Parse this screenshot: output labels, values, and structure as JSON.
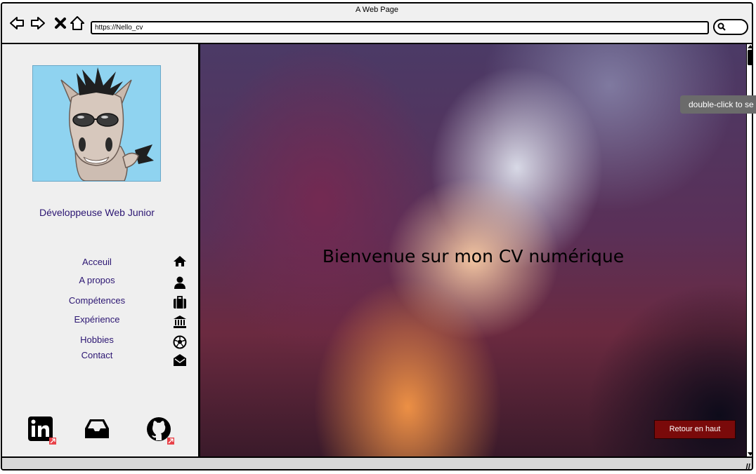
{
  "window": {
    "title": "A Web Page"
  },
  "browser": {
    "url": "https://Nello_cv"
  },
  "sidebar": {
    "role": "Développeuse Web Junior",
    "menu": [
      {
        "label": "Acceuil",
        "icon": "home-icon"
      },
      {
        "label": "A propos",
        "icon": "user-icon"
      },
      {
        "label": "Compétences",
        "icon": "briefcase-icon"
      },
      {
        "label": "Expérience",
        "icon": "bank-icon"
      },
      {
        "label": "Hobbies",
        "icon": "soccer-ball-icon"
      },
      {
        "label": "Contact",
        "icon": "envelope-open-icon"
      }
    ],
    "social": [
      "linkedin-icon",
      "inbox-icon",
      "github-icon"
    ]
  },
  "main": {
    "welcome": "Bienvenue sur mon CV numérique",
    "back_to_top": "Retour en haut"
  },
  "tooltip": {
    "text": "double-click to se"
  },
  "colors": {
    "accent": "#2b1572",
    "button": "#7a0a0a",
    "external_link": "#e8434a"
  }
}
